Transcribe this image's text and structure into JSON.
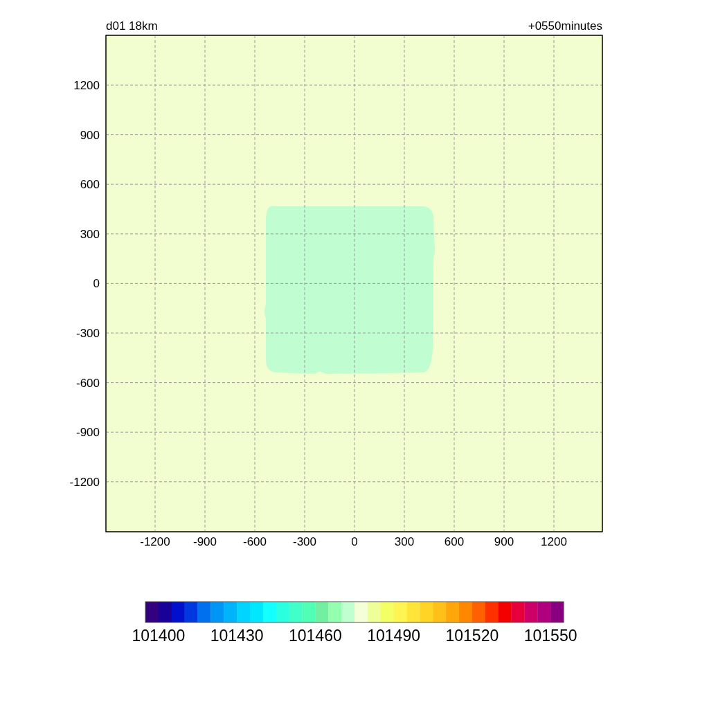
{
  "header": {
    "left": "d01 18km",
    "right": "+0550minutes"
  },
  "plot": {
    "xticks": [
      "-1200",
      "-900",
      "-600",
      "-300",
      "0",
      "300",
      "600",
      "900",
      "1200"
    ],
    "yticks": [
      "1200",
      "900",
      "600",
      "300",
      "0",
      "-300",
      "-600",
      "-900",
      "-1200"
    ]
  },
  "colorbar": {
    "boxes": [
      {
        "color": "#33007f"
      },
      {
        "color": "#180099"
      },
      {
        "color": "#0010cc"
      },
      {
        "color": "#0038e0"
      },
      {
        "color": "#0070ee"
      },
      {
        "color": "#0096f5"
      },
      {
        "color": "#00b4fc"
      },
      {
        "color": "#00d4ff"
      },
      {
        "color": "#00e8ff"
      },
      {
        "color": "#14ffff"
      },
      {
        "color": "#2affe0"
      },
      {
        "color": "#40ffc8"
      },
      {
        "color": "#50ffb4"
      },
      {
        "color": "#70f0a0"
      },
      {
        "color": "#95ffb0"
      },
      {
        "color": "#c0ffd0"
      },
      {
        "color": "#f4ffd8"
      },
      {
        "color": "#eeff99"
      },
      {
        "color": "#f4ff66"
      },
      {
        "color": "#fff552"
      },
      {
        "color": "#ffe43a"
      },
      {
        "color": "#ffd424"
      },
      {
        "color": "#ffc018"
      },
      {
        "color": "#ffa60a"
      },
      {
        "color": "#ff8800"
      },
      {
        "color": "#ff6000"
      },
      {
        "color": "#ff3000"
      },
      {
        "color": "#f50000"
      },
      {
        "color": "#e6003c"
      },
      {
        "color": "#cc0066"
      },
      {
        "color": "#b00080"
      },
      {
        "color": "#880080"
      }
    ],
    "labels": [
      "101400",
      "101430",
      "101460",
      "101490",
      "101520",
      "101550"
    ]
  }
}
